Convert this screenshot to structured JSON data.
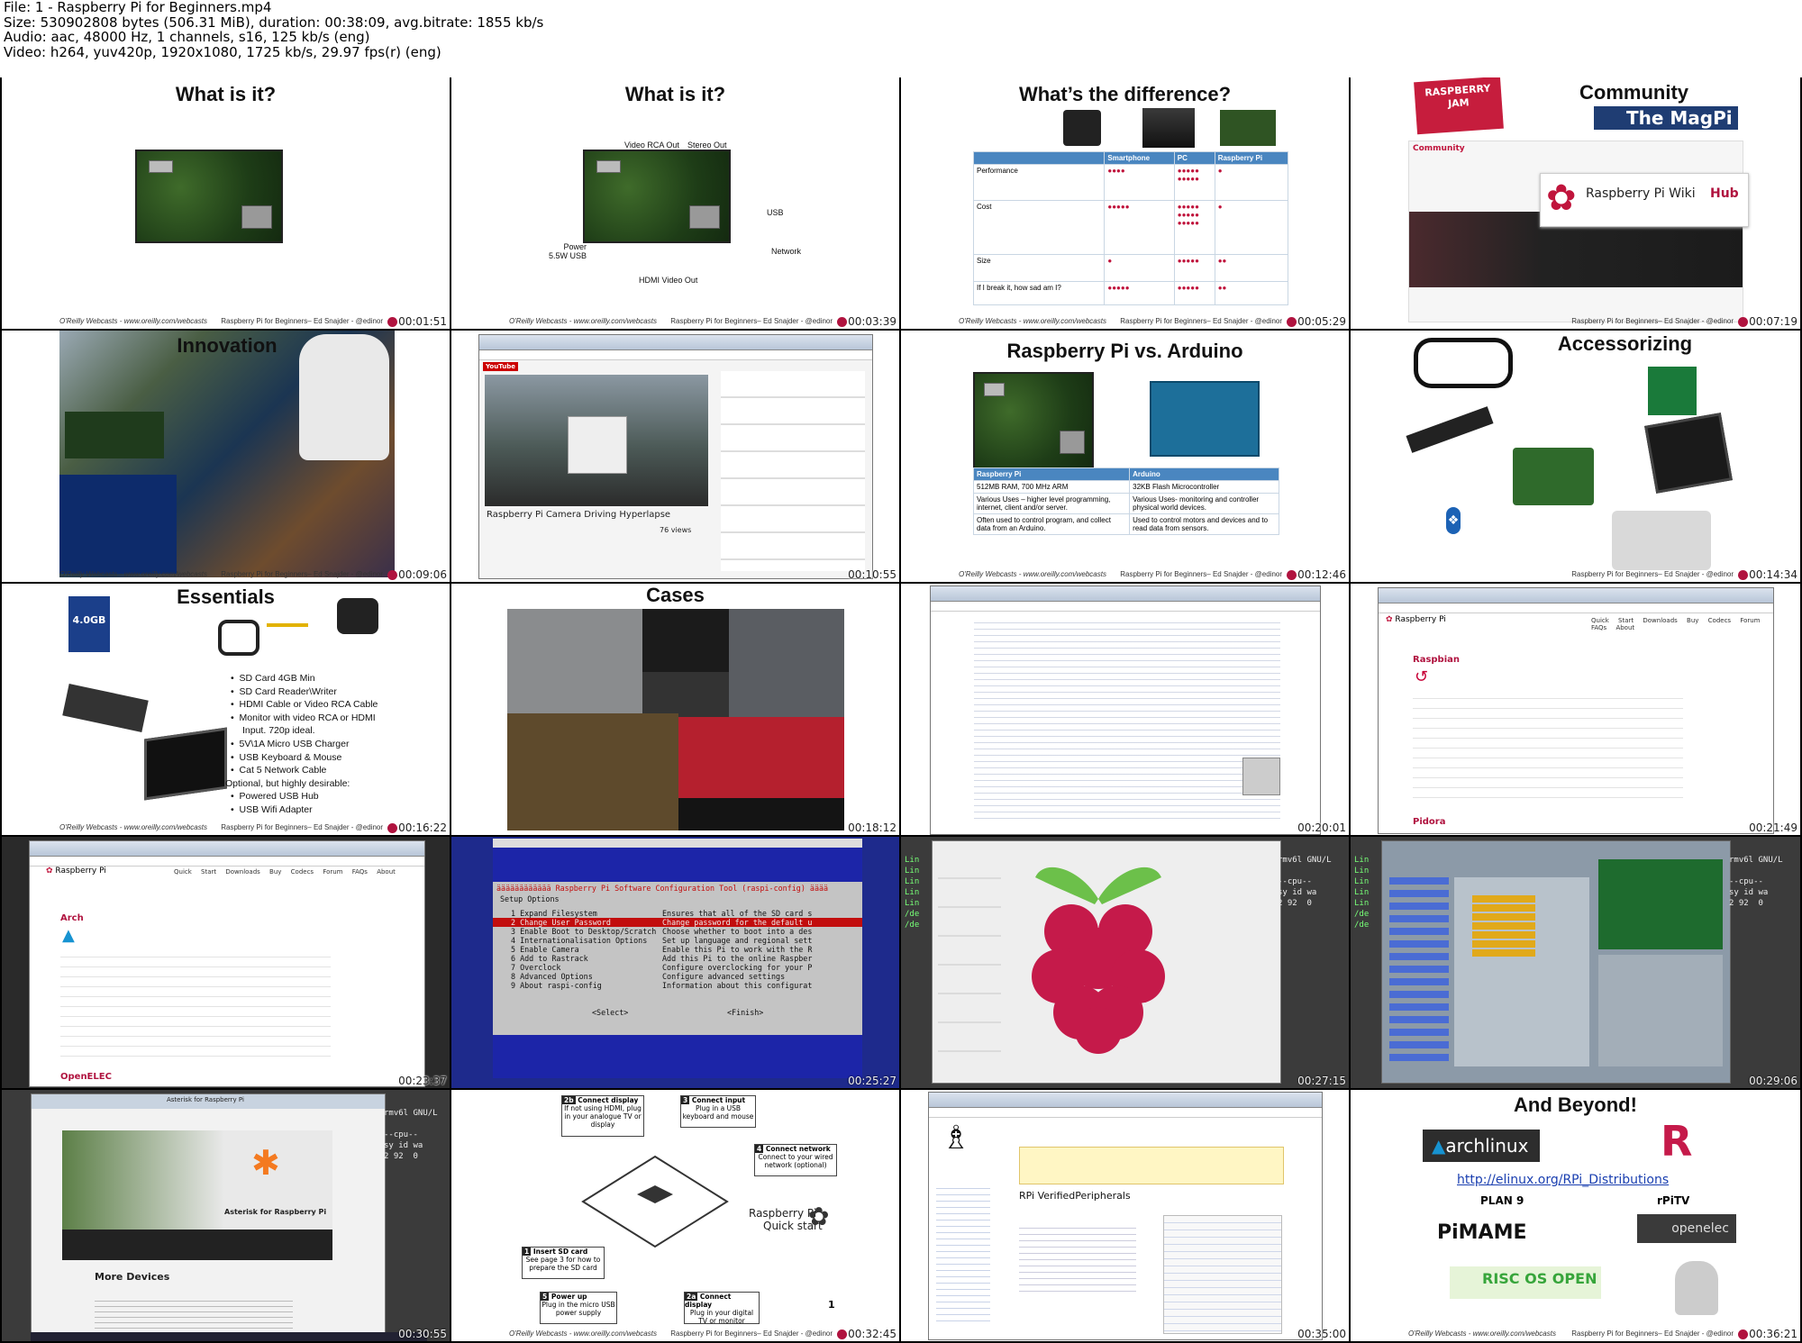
{
  "header": {
    "file": "File: 1 - Raspberry Pi for Beginners.mp4",
    "size": "Size: 530902808 bytes (506.31 MiB), duration: 00:38:09, avg.bitrate: 1855 kb/s",
    "audio": "Audio: aac, 48000 Hz, 1 channels, s16, 125 kb/s (eng)",
    "video": "Video: h264, yuv420p, 1920x1080, 1725 kb/s, 29.97 fps(r) (eng)"
  },
  "footer": {
    "left": "O'Reilly Webcasts - www.oreilly.com/webcasts",
    "right": "Raspberry Pi for Beginners– Ed Snajder - @edinor"
  },
  "thumbs": [
    {
      "time": "00:01:51",
      "title": "What is it?"
    },
    {
      "time": "00:03:39",
      "title": "What is it?",
      "labels": {
        "video": "Video RCA Out",
        "stereo": "Stereo Out",
        "usb": "USB",
        "power": "Power\n5.5W USB",
        "network": "Network",
        "hdmi": "HDMI Video Out"
      }
    },
    {
      "time": "00:05:29",
      "title": "What’s the difference?",
      "table": {
        "headers": [
          "",
          "Smartphone",
          "PC",
          "Raspberry Pi"
        ],
        "rows": [
          "Performance",
          "Cost",
          "Size",
          "If I break it, how sad am I?"
        ]
      }
    },
    {
      "time": "00:07:19",
      "title": "Community",
      "wiki": "Raspberry Pi Wiki",
      "hub": "Hub",
      "jam": "RASPBERRY JAM",
      "magpi": "The MagPi",
      "community": "Community"
    },
    {
      "time": "00:09:06",
      "title": "Innovation"
    },
    {
      "time": "00:10:55",
      "video_title": "Raspberry Pi Camera Driving Hyperlapse",
      "views": "76 views",
      "site": "YouTube"
    },
    {
      "time": "00:12:46",
      "title": "Raspberry Pi vs. Arduino",
      "table": {
        "headers": [
          "Raspberry Pi",
          "Arduino"
        ],
        "rows": [
          [
            "512MB RAM, 700 MHz ARM",
            "32KB Flash Microcontroller"
          ],
          [
            "Various Uses – higher level programming, internet, client and/or server.",
            "Various Uses- monitoring and controller physical world devices."
          ],
          [
            "Often used to control program, and collect data from an Arduino.",
            "Used to control motors and devices and to read data from sensors."
          ]
        ]
      }
    },
    {
      "time": "00:14:34",
      "title": "Accessorizing"
    },
    {
      "time": "00:16:22",
      "title": "Essentials",
      "sd": "4.0GB",
      "bullets": [
        "SD Card 4GB Min",
        "SD Card Reader\\Writer",
        "HDMI Cable or Video RCA Cable",
        "Monitor with video RCA or HDMI Input. 720p ideal.",
        "5V\\1A Micro USB Charger",
        "USB Keyboard & Mouse",
        "Cat 5 Network Cable"
      ],
      "optional": "Optional, but highly desirable:",
      "optional_bullets": [
        "Powered USB Hub",
        "USB Wifi Adapter"
      ]
    },
    {
      "time": "00:18:12",
      "title": "Cases"
    },
    {
      "time": "00:20:01"
    },
    {
      "time": "00:21:49",
      "heading": "Raspbian",
      "heading2": "Pidora",
      "site": "Raspberry Pi",
      "nav": [
        "Quick Start",
        "Downloads",
        "Buy Codecs",
        "Forum",
        "FAQs",
        "About"
      ]
    },
    {
      "time": "00:23:37",
      "heading": "Arch",
      "heading2": "OpenELEC",
      "site": "Raspberry Pi",
      "nav": [
        "Quick Start",
        "Downloads",
        "Buy Codecs",
        "Forum",
        "FAQs",
        "About"
      ]
    },
    {
      "time": "00:25:27",
      "config_title": "Raspberry Pi Software Configuration Tool (raspi-config)",
      "setup": "Setup Options",
      "items": [
        [
          "1 Expand Filesystem",
          "Ensures that all of the SD card s"
        ],
        [
          "2 Change User Password",
          "Change password for the default u"
        ],
        [
          "3 Enable Boot to Desktop/Scratch",
          "Choose whether to boot into a des"
        ],
        [
          "4 Internationalisation Options",
          "Set up language and regional sett"
        ],
        [
          "5 Enable Camera",
          "Enable this Pi to work with the R"
        ],
        [
          "6 Add to Rastrack",
          "Add this Pi to the online Raspber"
        ],
        [
          "7 Overclock",
          "Configure overclocking for your P"
        ],
        [
          "8 Advanced Options",
          "Configure advanced settings"
        ],
        [
          "9 About raspi-config",
          "Information about this configurat"
        ]
      ],
      "select": "<Select>",
      "finish": "<Finish>"
    },
    {
      "time": "00:27:15",
      "term": "rmv6l GNU/L",
      "cpu": "--cpu--",
      "sy": "sy id wa",
      "nums": "2 92  0"
    },
    {
      "time": "00:29:06",
      "term": "rmv6l GNU/L",
      "cpu": "--cpu--",
      "sy": "sy id wa",
      "nums": "2 92  0"
    },
    {
      "time": "00:30:55",
      "page_title": "Asterisk for Raspberry Pi",
      "more": "More Devices",
      "term": "rmv6l GNU/L",
      "cpu": "--cpu--",
      "sy": "sy id wa",
      "nums": "2 92  0"
    },
    {
      "time": "00:32:45",
      "steps": [
        {
          "n": "2b",
          "t": "Connect display",
          "d": "If not using HDMI, plug in your analogue TV or display"
        },
        {
          "n": "3",
          "t": "Connect input",
          "d": "Plug in a USB keyboard and mouse"
        },
        {
          "n": "4",
          "t": "Connect network",
          "d": "Connect to your wired network (optional)"
        },
        {
          "n": "1",
          "t": "Insert SD card",
          "d": "See page 3 for how to prepare the SD card"
        },
        {
          "n": "5",
          "t": "Power up",
          "d": "Plug in the micro USB power supply"
        },
        {
          "n": "2a",
          "t": "Connect display",
          "d": "Plug in your digital TV or monitor"
        }
      ],
      "brand": "Raspberry Pi",
      "quick": "Quick start",
      "page": "1"
    },
    {
      "time": "00:35:00",
      "heading": "RPi VerifiedPeripherals"
    },
    {
      "time": "00:36:21",
      "title": "And Beyond!",
      "link": "http://elinux.org/RPi_Distributions",
      "arch": "archlinux",
      "plan9": "PLAN 9",
      "rpitv": "rPiTV",
      "pimame": "PiMAME",
      "openelec": "openelec",
      "riscos": "RISC OS OPEN"
    }
  ]
}
